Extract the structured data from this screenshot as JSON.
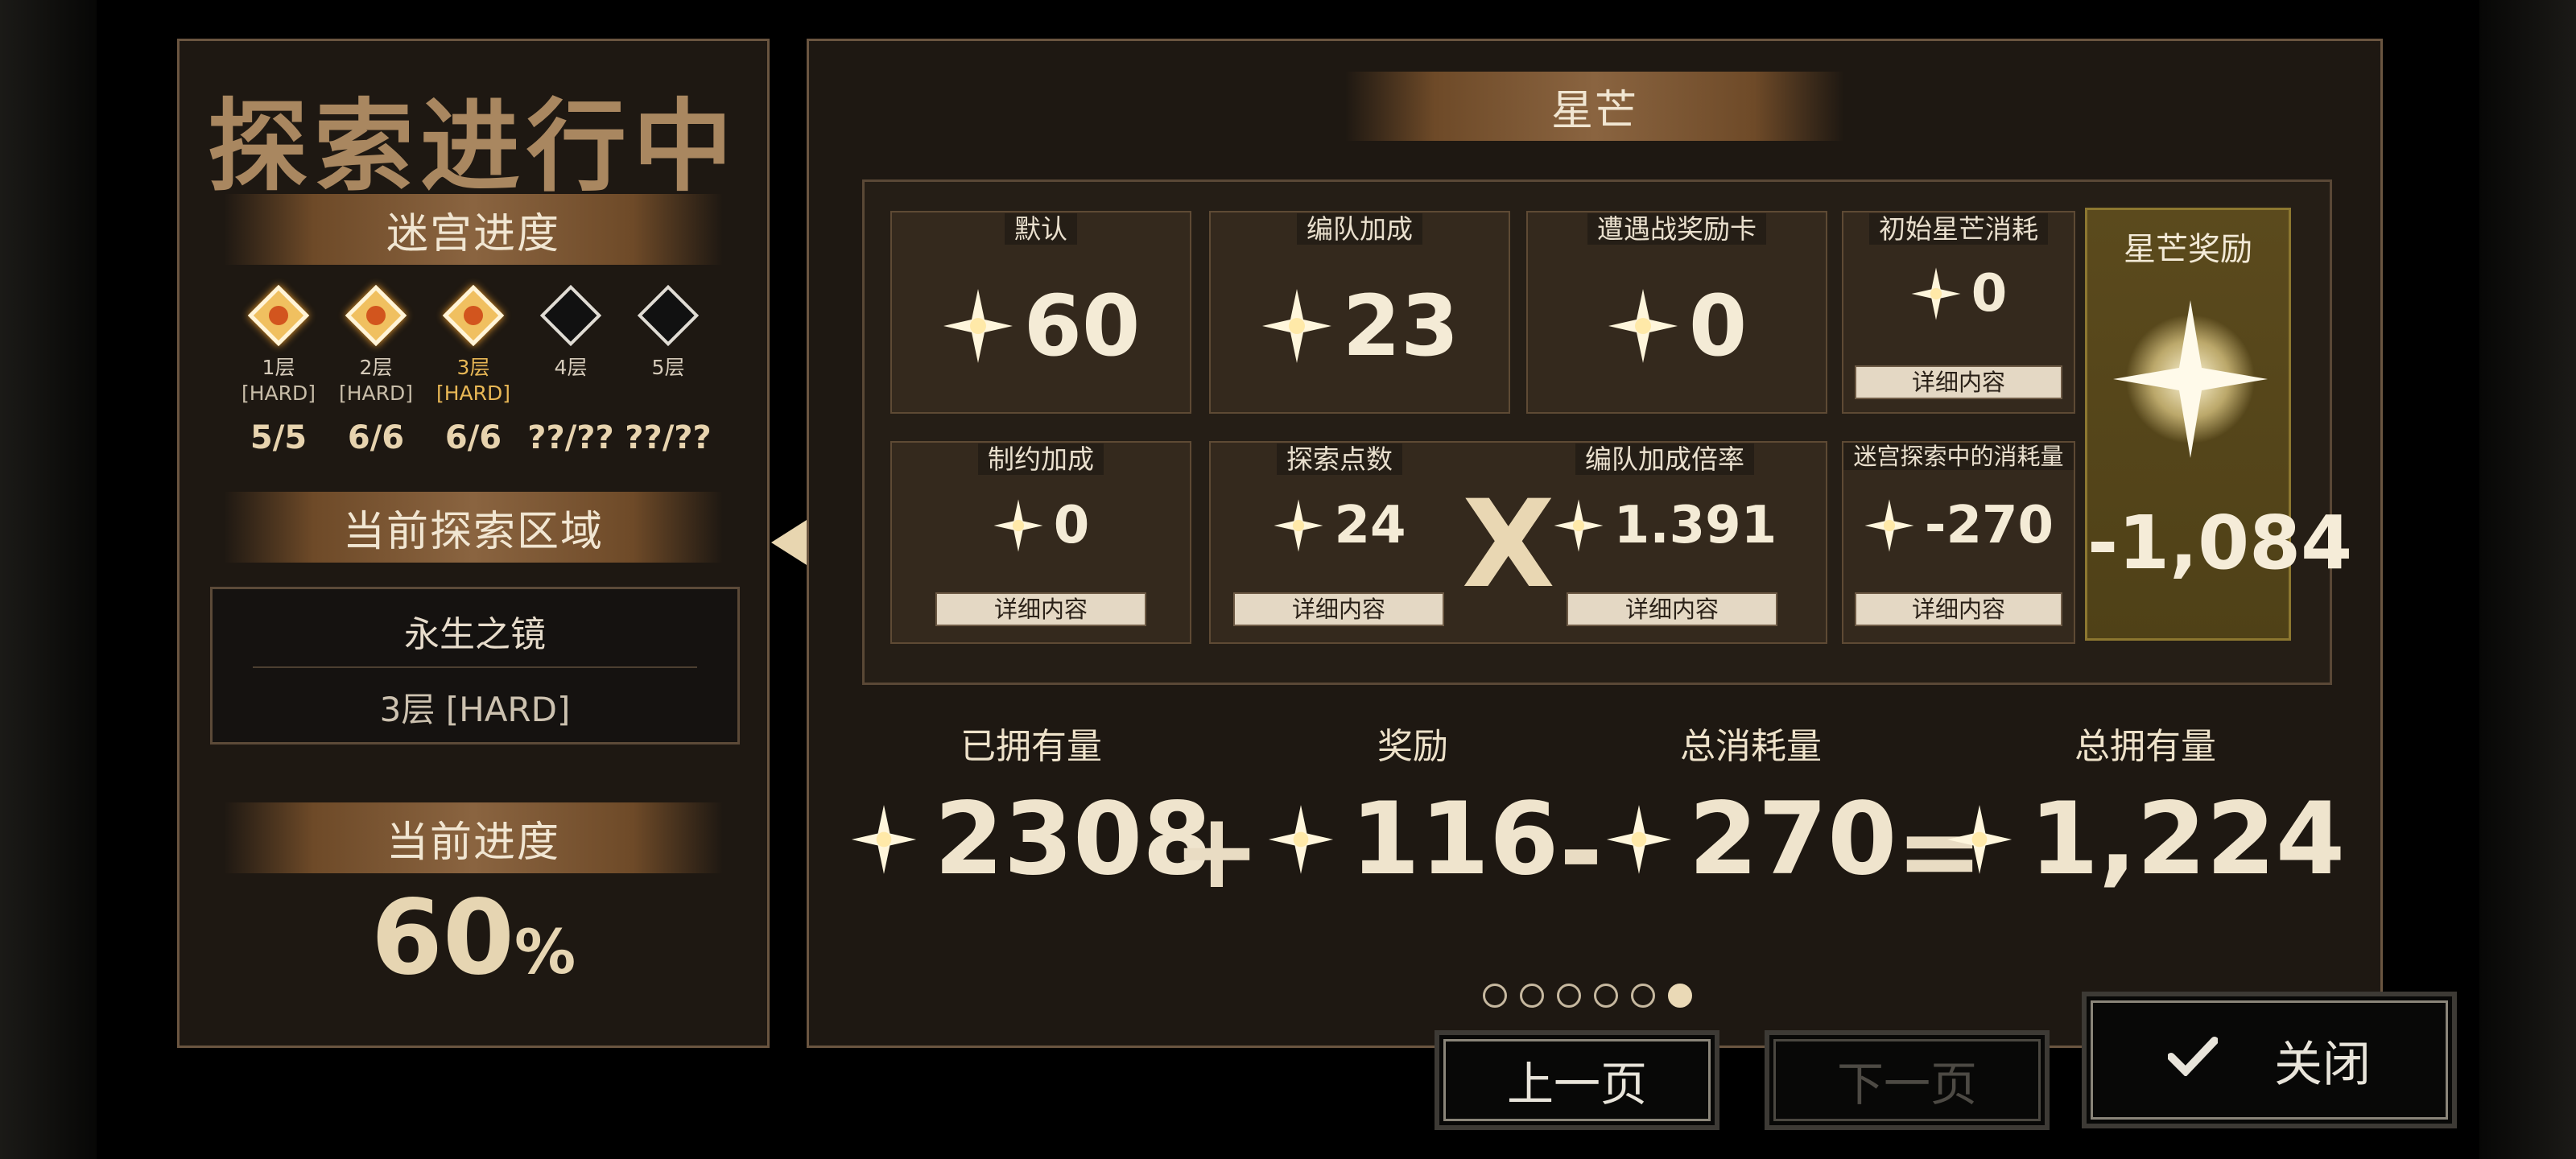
{
  "left": {
    "title": "探索进行中",
    "maze_progress_label": "迷宫进度",
    "floors": [
      {
        "label": "1层",
        "difficulty": "[HARD]",
        "count": "5/5",
        "status": "cleared"
      },
      {
        "label": "2层",
        "difficulty": "[HARD]",
        "count": "6/6",
        "status": "cleared"
      },
      {
        "label": "3层",
        "difficulty": "[HARD]",
        "count": "6/6",
        "status": "current"
      },
      {
        "label": "4层",
        "difficulty": "",
        "count": "??/??",
        "status": "locked"
      },
      {
        "label": "5层",
        "difficulty": "",
        "count": "??/??",
        "status": "locked"
      }
    ],
    "current_area_label": "当前探索区域",
    "area_name": "永生之镜",
    "area_floor": "3层 [HARD]",
    "current_progress_label": "当前进度",
    "progress_value": "60",
    "progress_unit": "%"
  },
  "right": {
    "banner": "星芒",
    "cells": {
      "default": {
        "label": "默认",
        "value": "60"
      },
      "team_bonus": {
        "label": "编队加成",
        "value": "23"
      },
      "encounter_card": {
        "label": "遭遇战奖励卡",
        "value": "0"
      },
      "initial_cost": {
        "label": "初始星芒消耗",
        "value": "0",
        "button": "详细内容"
      },
      "restriction_bonus": {
        "label": "制约加成",
        "value": "0",
        "button": "详细内容"
      },
      "explore_points": {
        "label": "探索点数",
        "value": "24",
        "button": "详细内容"
      },
      "multiplier_symbol": "X",
      "team_rate": {
        "label": "编队加成倍率",
        "value": "1.391",
        "button": "详细内容"
      },
      "maze_cost": {
        "label": "迷宫探索中的消耗量",
        "value": "-270",
        "button": "详细内容"
      }
    },
    "reward": {
      "label": "星芒奖励",
      "value": "-1,084"
    },
    "totals": {
      "owned": {
        "label": "已拥有量",
        "value": "2308"
      },
      "plus": "+",
      "reward": {
        "label": "奖励",
        "value": "116"
      },
      "minus": "-",
      "total_cost": {
        "label": "总消耗量",
        "value": "270"
      },
      "equals": "=",
      "total_owned": {
        "label": "总拥有量",
        "value": "1,224"
      }
    },
    "pagination": {
      "total": 6,
      "current": 6
    }
  },
  "buttons": {
    "prev": "上一页",
    "next": "下一页",
    "close": "关闭",
    "close_icon": "check-icon",
    "prev_arrow_icon": "triangle-left-icon"
  },
  "colors": {
    "panel_bg": "#1e1812",
    "border": "#6a5540",
    "accent_gold": "#e9b856",
    "reward_bg": "#5b4a1d"
  }
}
